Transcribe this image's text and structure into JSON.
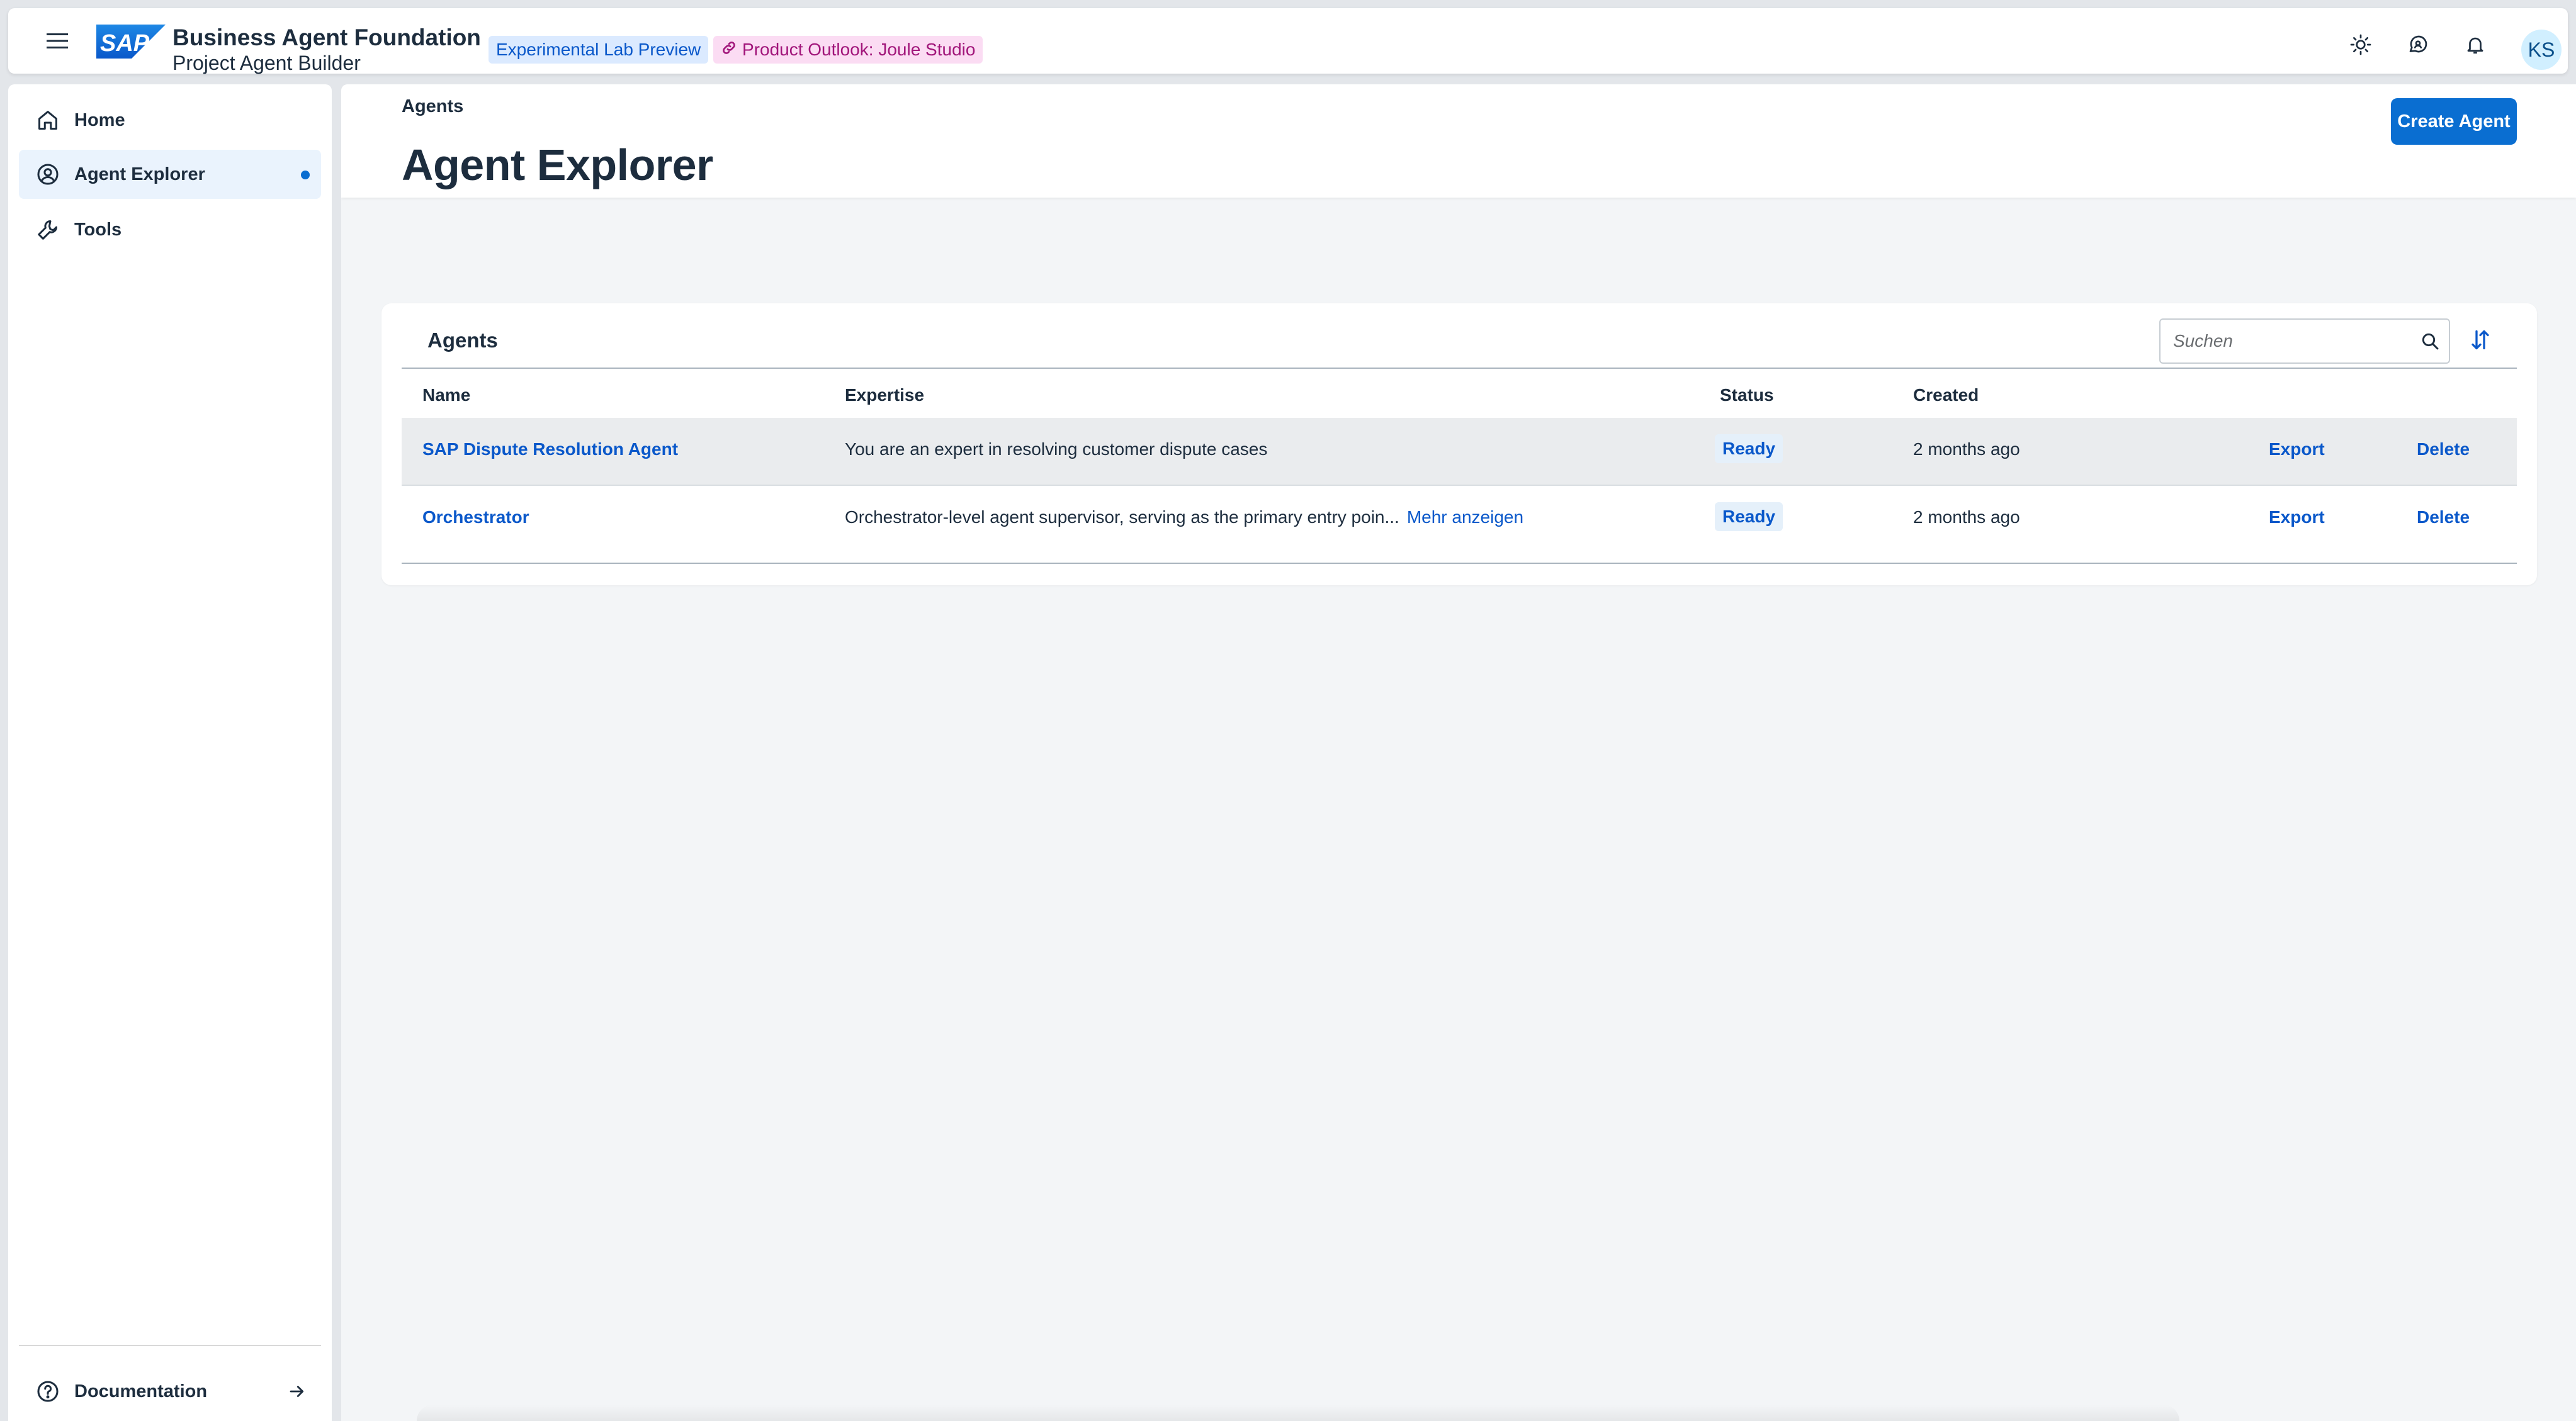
{
  "shell": {
    "logo_text": "SAP",
    "title": "Business Agent Foundation",
    "subtitle": "Project Agent Builder",
    "tag_lab": "Experimental Lab Preview",
    "tag_outlook": "Product Outlook: Joule Studio",
    "avatar_initials": "KS",
    "icons": [
      "menu-icon",
      "theme-sun-icon",
      "feedback-icon",
      "notification-bell-icon"
    ]
  },
  "sidenav": {
    "items": [
      {
        "label": "Home",
        "icon": "home-icon",
        "selected": false
      },
      {
        "label": "Agent Explorer",
        "icon": "person-icon",
        "selected": true
      },
      {
        "label": "Tools",
        "icon": "wrench-icon",
        "selected": false
      }
    ],
    "footer_item": {
      "label": "Documentation",
      "icon": "help-circle-icon",
      "trailing_icon": "arrow-right-icon"
    }
  },
  "header": {
    "breadcrumb": "Agents",
    "title": "Agent Explorer",
    "create_button": "Create Agent"
  },
  "table": {
    "title": "Agents",
    "search_placeholder": "Suchen",
    "columns": [
      "Name",
      "Expertise",
      "Status",
      "Created"
    ],
    "rows": [
      {
        "name": "SAP Dispute Resolution Agent",
        "expertise": "You are an expert in resolving customer dispute cases",
        "more": "",
        "status": "Ready",
        "created": "2 months ago",
        "export": "Export",
        "delete": "Delete"
      },
      {
        "name": "Orchestrator",
        "expertise": "Orchestrator-level agent supervisor, serving as the primary entry poin...",
        "more": "Mehr anzeigen",
        "status": "Ready",
        "created": "2 months ago",
        "export": "Export",
        "delete": "Delete"
      }
    ]
  },
  "colors": {
    "accent": "#0a6ed1",
    "link": "#0a58ca",
    "background": "#f3f5f7",
    "text": "#1d2d3e"
  }
}
